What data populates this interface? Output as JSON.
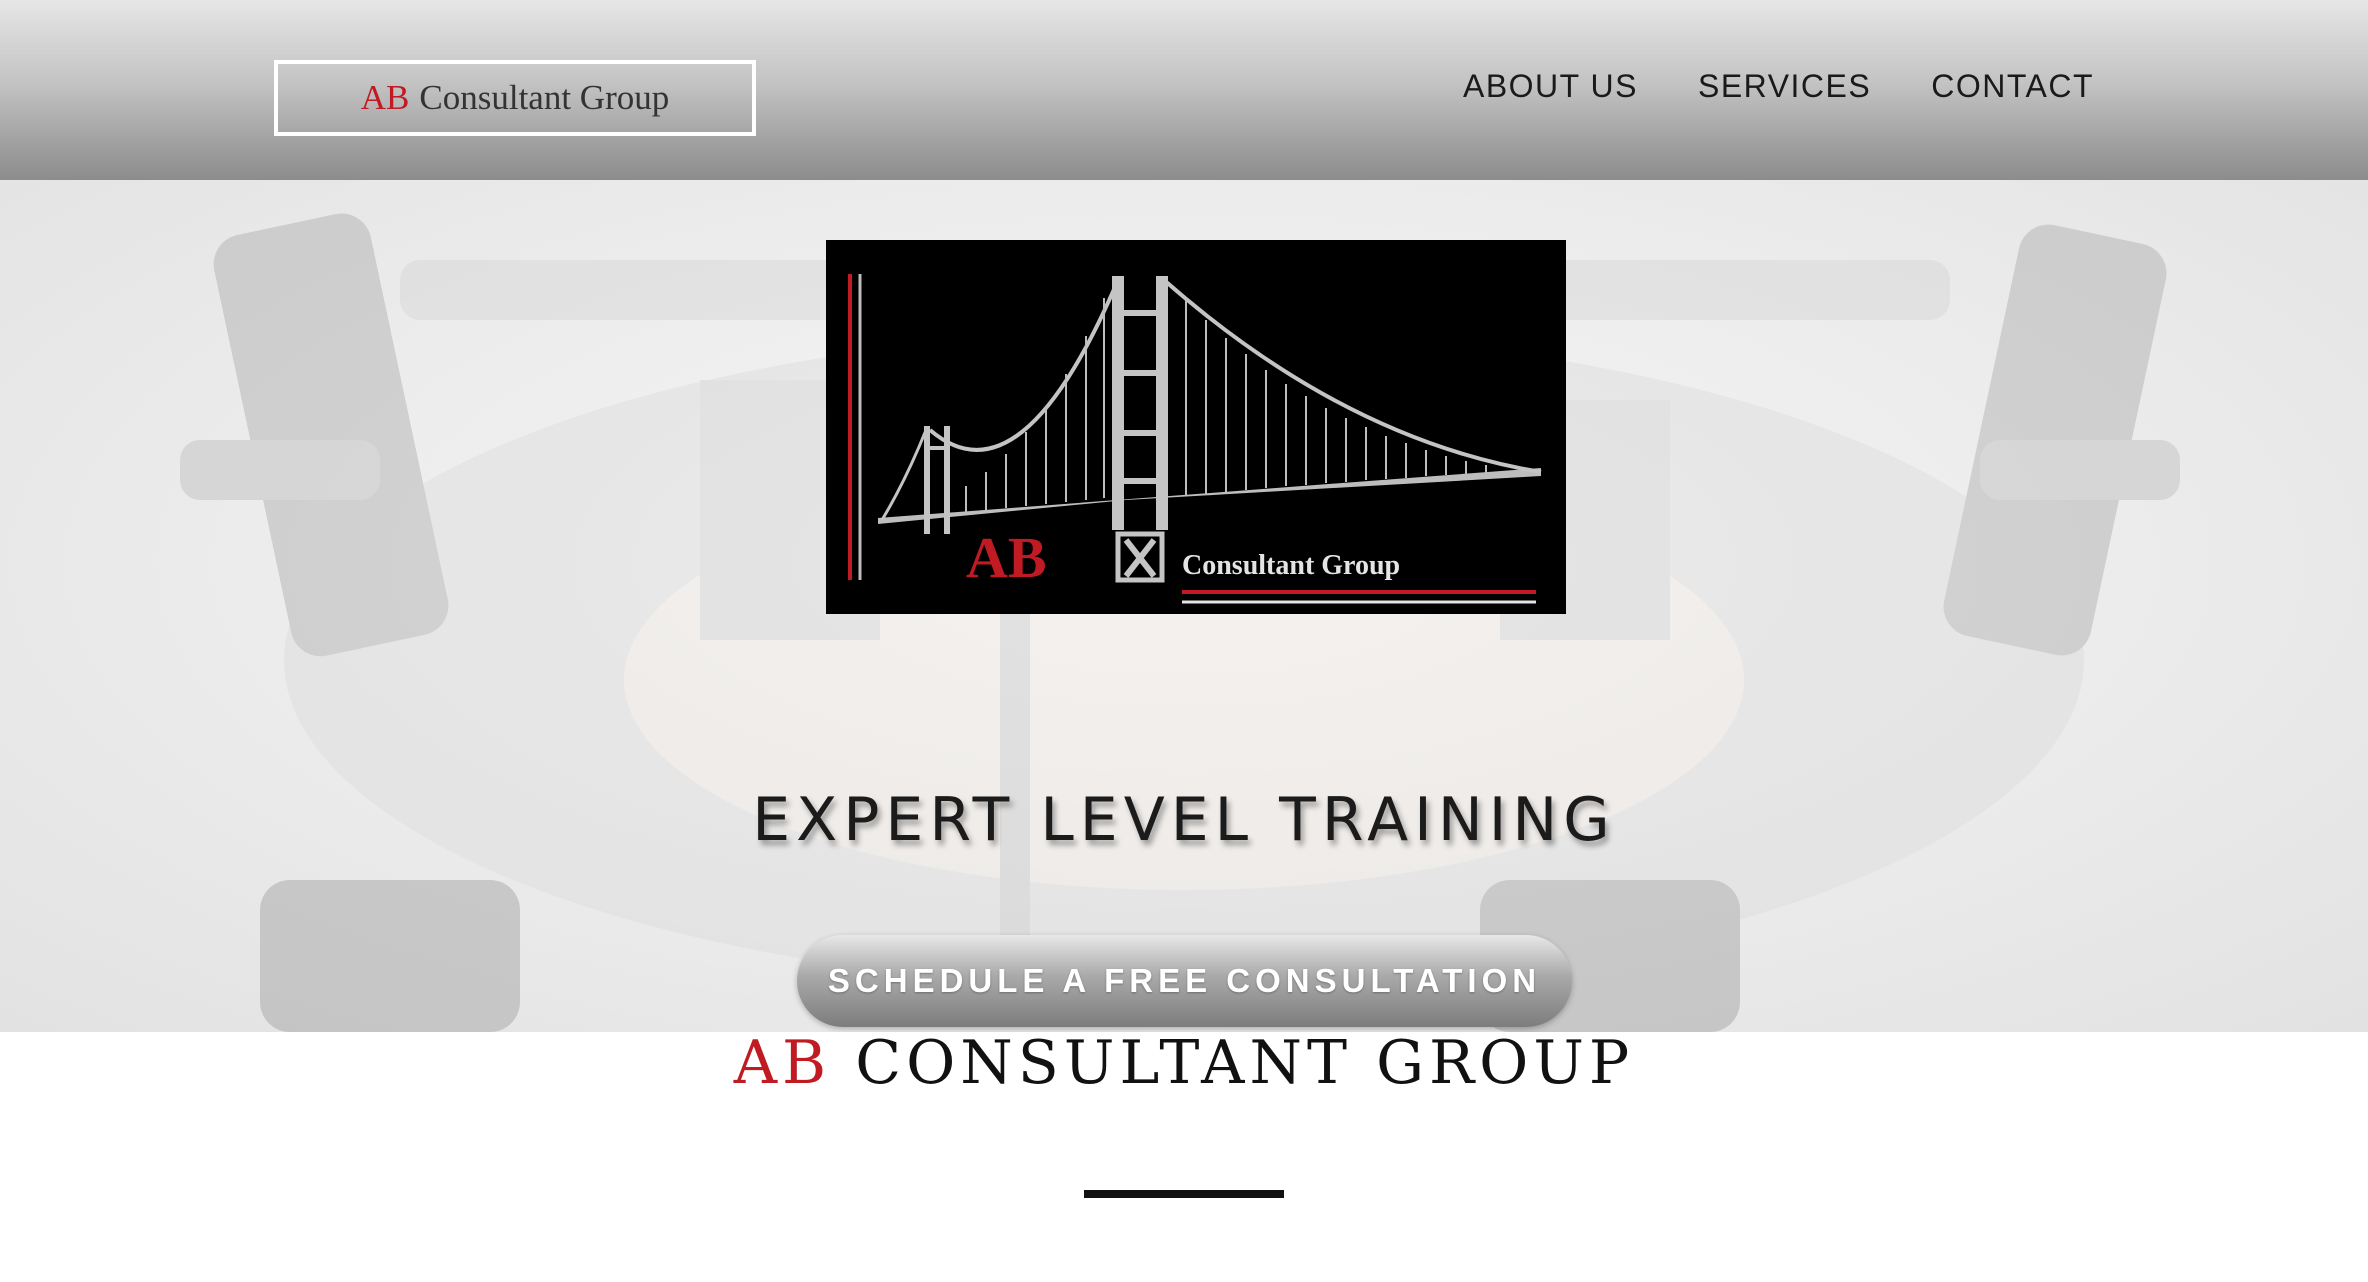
{
  "header": {
    "logo": {
      "ab": "AB",
      "rest": "Consultant Group"
    },
    "nav": [
      "ABOUT US",
      "SERVICES",
      "CONTACT"
    ]
  },
  "hero": {
    "logo_card": {
      "ab": "AB",
      "text": "Consultant Group"
    },
    "headline": "EXPERT LEVEL TRAINING",
    "cta_label": "SCHEDULE A FREE CONSULTATION"
  },
  "section": {
    "heading_ab": "AB",
    "heading_rest": "CONSULTANT GROUP"
  },
  "colors": {
    "accent_red": "#c01a22",
    "header_gradient_top": "#e6e6e6",
    "header_gradient_bottom": "#8c8c8c"
  }
}
